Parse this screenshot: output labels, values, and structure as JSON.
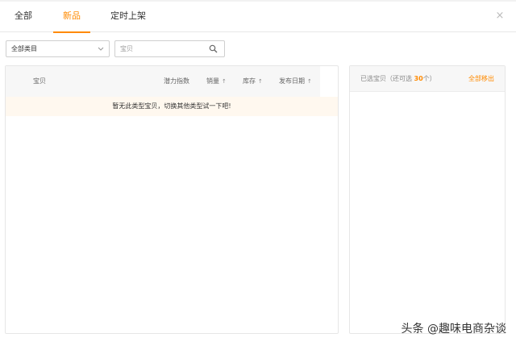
{
  "tabs": [
    {
      "label": "全部"
    },
    {
      "label": "新品"
    },
    {
      "label": "定时上架"
    }
  ],
  "close_icon": "×",
  "filters": {
    "category_value": "全部类目",
    "search_placeholder": "宝贝"
  },
  "table": {
    "columns": [
      {
        "label": "宝贝"
      },
      {
        "label": "潜力指数"
      },
      {
        "label": "销量",
        "sort_glyph": "↑"
      },
      {
        "label": "库存",
        "sort_glyph": "↑"
      },
      {
        "label": "发布日期",
        "sort_glyph": "↑"
      }
    ],
    "empty_message": "暂无此类型宝贝，切换其他类型试一下吧!"
  },
  "selected_panel": {
    "label_prefix": "已选宝贝（还可选 ",
    "remaining_count": "30",
    "label_suffix": "个）",
    "remove_all_label": "全部移出"
  },
  "watermark": "头条 @趣味电商杂谈",
  "colors": {
    "accent": "#ff8a00",
    "empty_row_bg": "#fff8ef",
    "header_bg": "#f7f7f7"
  }
}
